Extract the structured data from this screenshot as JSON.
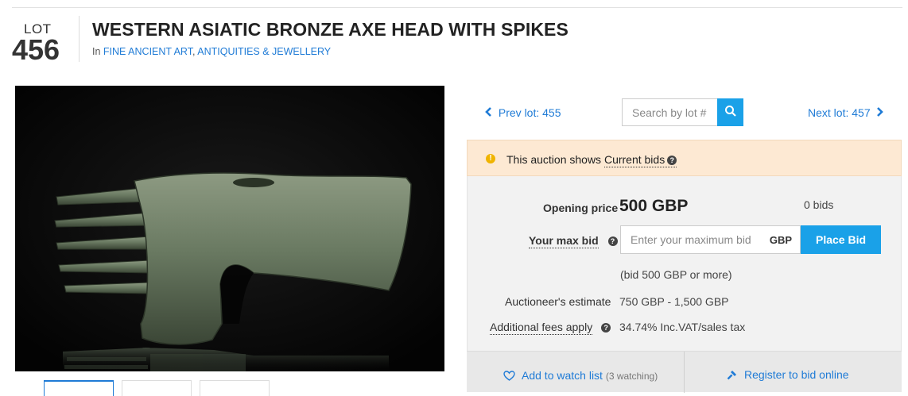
{
  "lot": {
    "word": "LOT",
    "number": "456"
  },
  "title": "WESTERN ASIATIC BRONZE AXE HEAD WITH SPIKES",
  "breadcrumb": {
    "prefix": "In",
    "part1": "FINE ANCIENT ART",
    "sep": ",",
    "part2": "ANTIQUITIES & JEWELLERY"
  },
  "nav": {
    "prev_label": "Prev lot: 455",
    "next_label": "Next lot: 457",
    "search_placeholder": "Search by lot #",
    "search_icon": "search-icon"
  },
  "notice": {
    "text": "This auction shows",
    "link": "Current bids"
  },
  "bid": {
    "opening_label": "Opening price",
    "opening_value": "500",
    "opening_currency": "GBP",
    "bids_count": "0 bids",
    "max_bid_label": "Your max bid",
    "max_bid_placeholder": "Enter your maximum bid",
    "currency": "GBP",
    "place_bid": "Place Bid",
    "hint": "(bid 500 GBP or more)",
    "estimate_label": "Auctioneer's estimate",
    "estimate_value": "750 GBP - 1,500 GBP",
    "fees_label": "Additional fees apply",
    "fees_value": "34.74% Inc.VAT/sales tax"
  },
  "actions": {
    "watch_label": "Add to watch list",
    "watch_count": "(3 watching)",
    "register_label": "Register to bid online"
  },
  "colors": {
    "accent": "#1aa1e8",
    "link": "#1f7bd6",
    "notice_bg": "#fde9d3",
    "panel_bg": "#f2f2f2"
  }
}
